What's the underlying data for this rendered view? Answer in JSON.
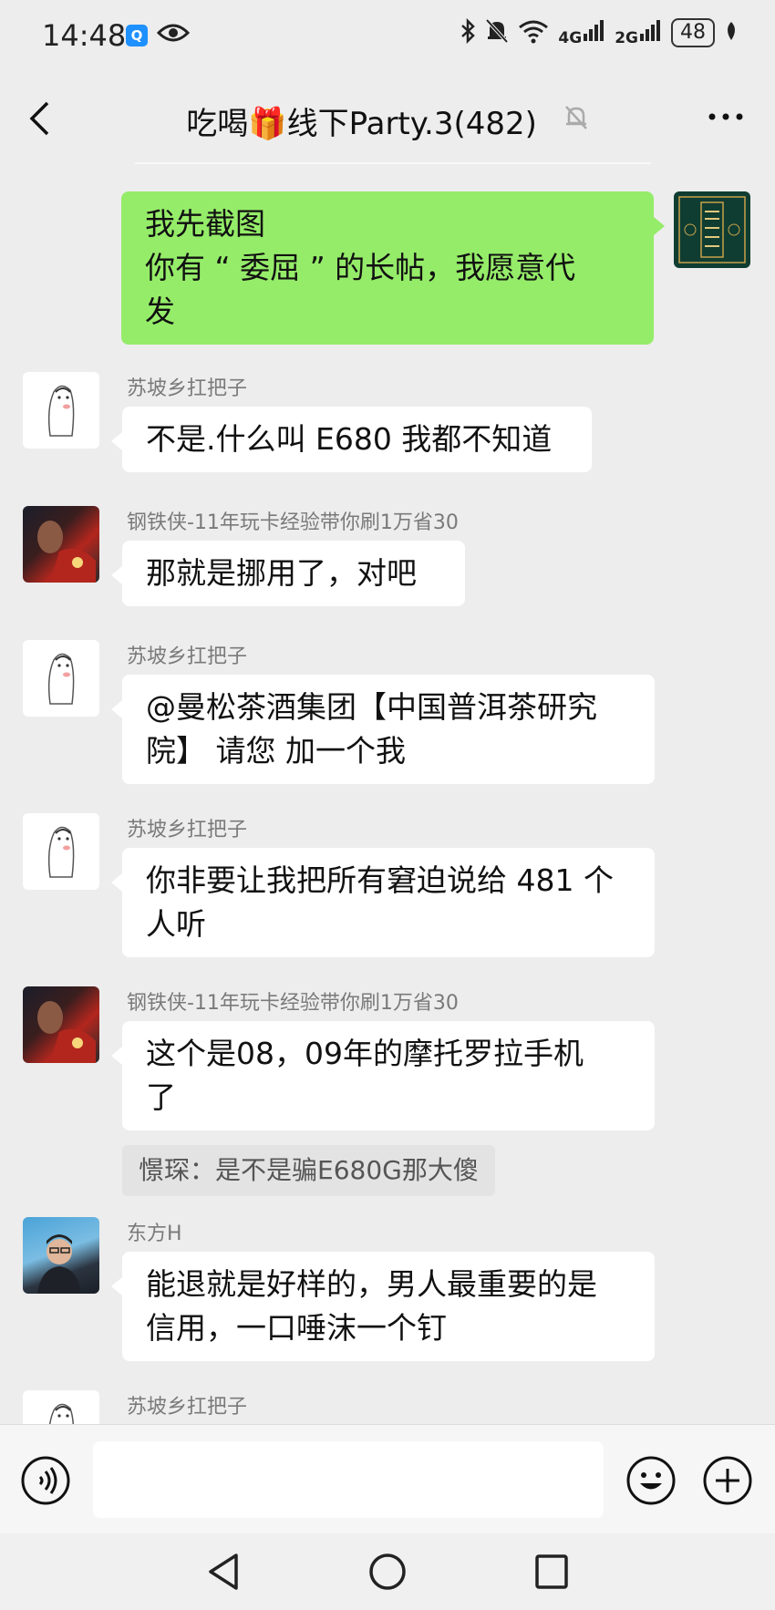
{
  "status_bar": {
    "time": "14:48",
    "signal_4g": "4G",
    "signal_2g": "2G",
    "battery": "48",
    "icons": [
      "search-app-icon",
      "eye-icon",
      "bluetooth-icon",
      "bell-off-icon",
      "wifi-icon",
      "signal-4g-icon",
      "signal-2g-icon",
      "battery-icon",
      "leaf-icon"
    ]
  },
  "header": {
    "title": "吃喝🎁线下Party.3(482)",
    "icons": [
      "back-icon",
      "mute-bell-icon",
      "more-icon"
    ]
  },
  "messages": [
    {
      "sender": "",
      "text": [
        "我先截图",
        "你有 “ 委屈 ” 的长帖，我愿意代",
        "发"
      ],
      "mine": true
    },
    {
      "sender": "苏坡乡扛把子",
      "text": [
        "不是.什么叫 E680 我都不知道"
      ]
    },
    {
      "sender": "钢铁侠-11年玩卡经验带你刷1万省30",
      "text": [
        "那就是挪用了，对吧"
      ]
    },
    {
      "sender": "苏坡乡扛把子",
      "text": [
        "@曼松茶酒集团【中国普洱茶研究",
        "院】  请您 加一个我"
      ]
    },
    {
      "sender": "苏坡乡扛把子",
      "text": [
        "你非要让我把所有窘迫说给 481 个",
        "人听"
      ]
    },
    {
      "sender": "钢铁侠-11年玩卡经验带你刷1万省30",
      "text": [
        "这个是08，09年的摩托罗拉手机",
        "了"
      ],
      "quote": "憬琛：是不是骗E680G那大傻"
    },
    {
      "sender": "东方H",
      "text": [
        "能退就是好样的，男人最重要的是",
        "信用，一口唾沫一个钉"
      ]
    },
    {
      "sender": "苏坡乡扛把子",
      "text": []
    }
  ],
  "input_bar": {
    "placeholder": "",
    "icons": [
      "voice-icon",
      "emoji-icon",
      "plus-icon"
    ]
  },
  "system_nav": {
    "icons": [
      "nav-back-icon",
      "nav-home-icon",
      "nav-recents-icon"
    ]
  },
  "colors": {
    "background": "#ededed",
    "my_bubble": "#95ec69",
    "other_bubble": "#ffffff",
    "sender_name": "#7a7a7a"
  }
}
